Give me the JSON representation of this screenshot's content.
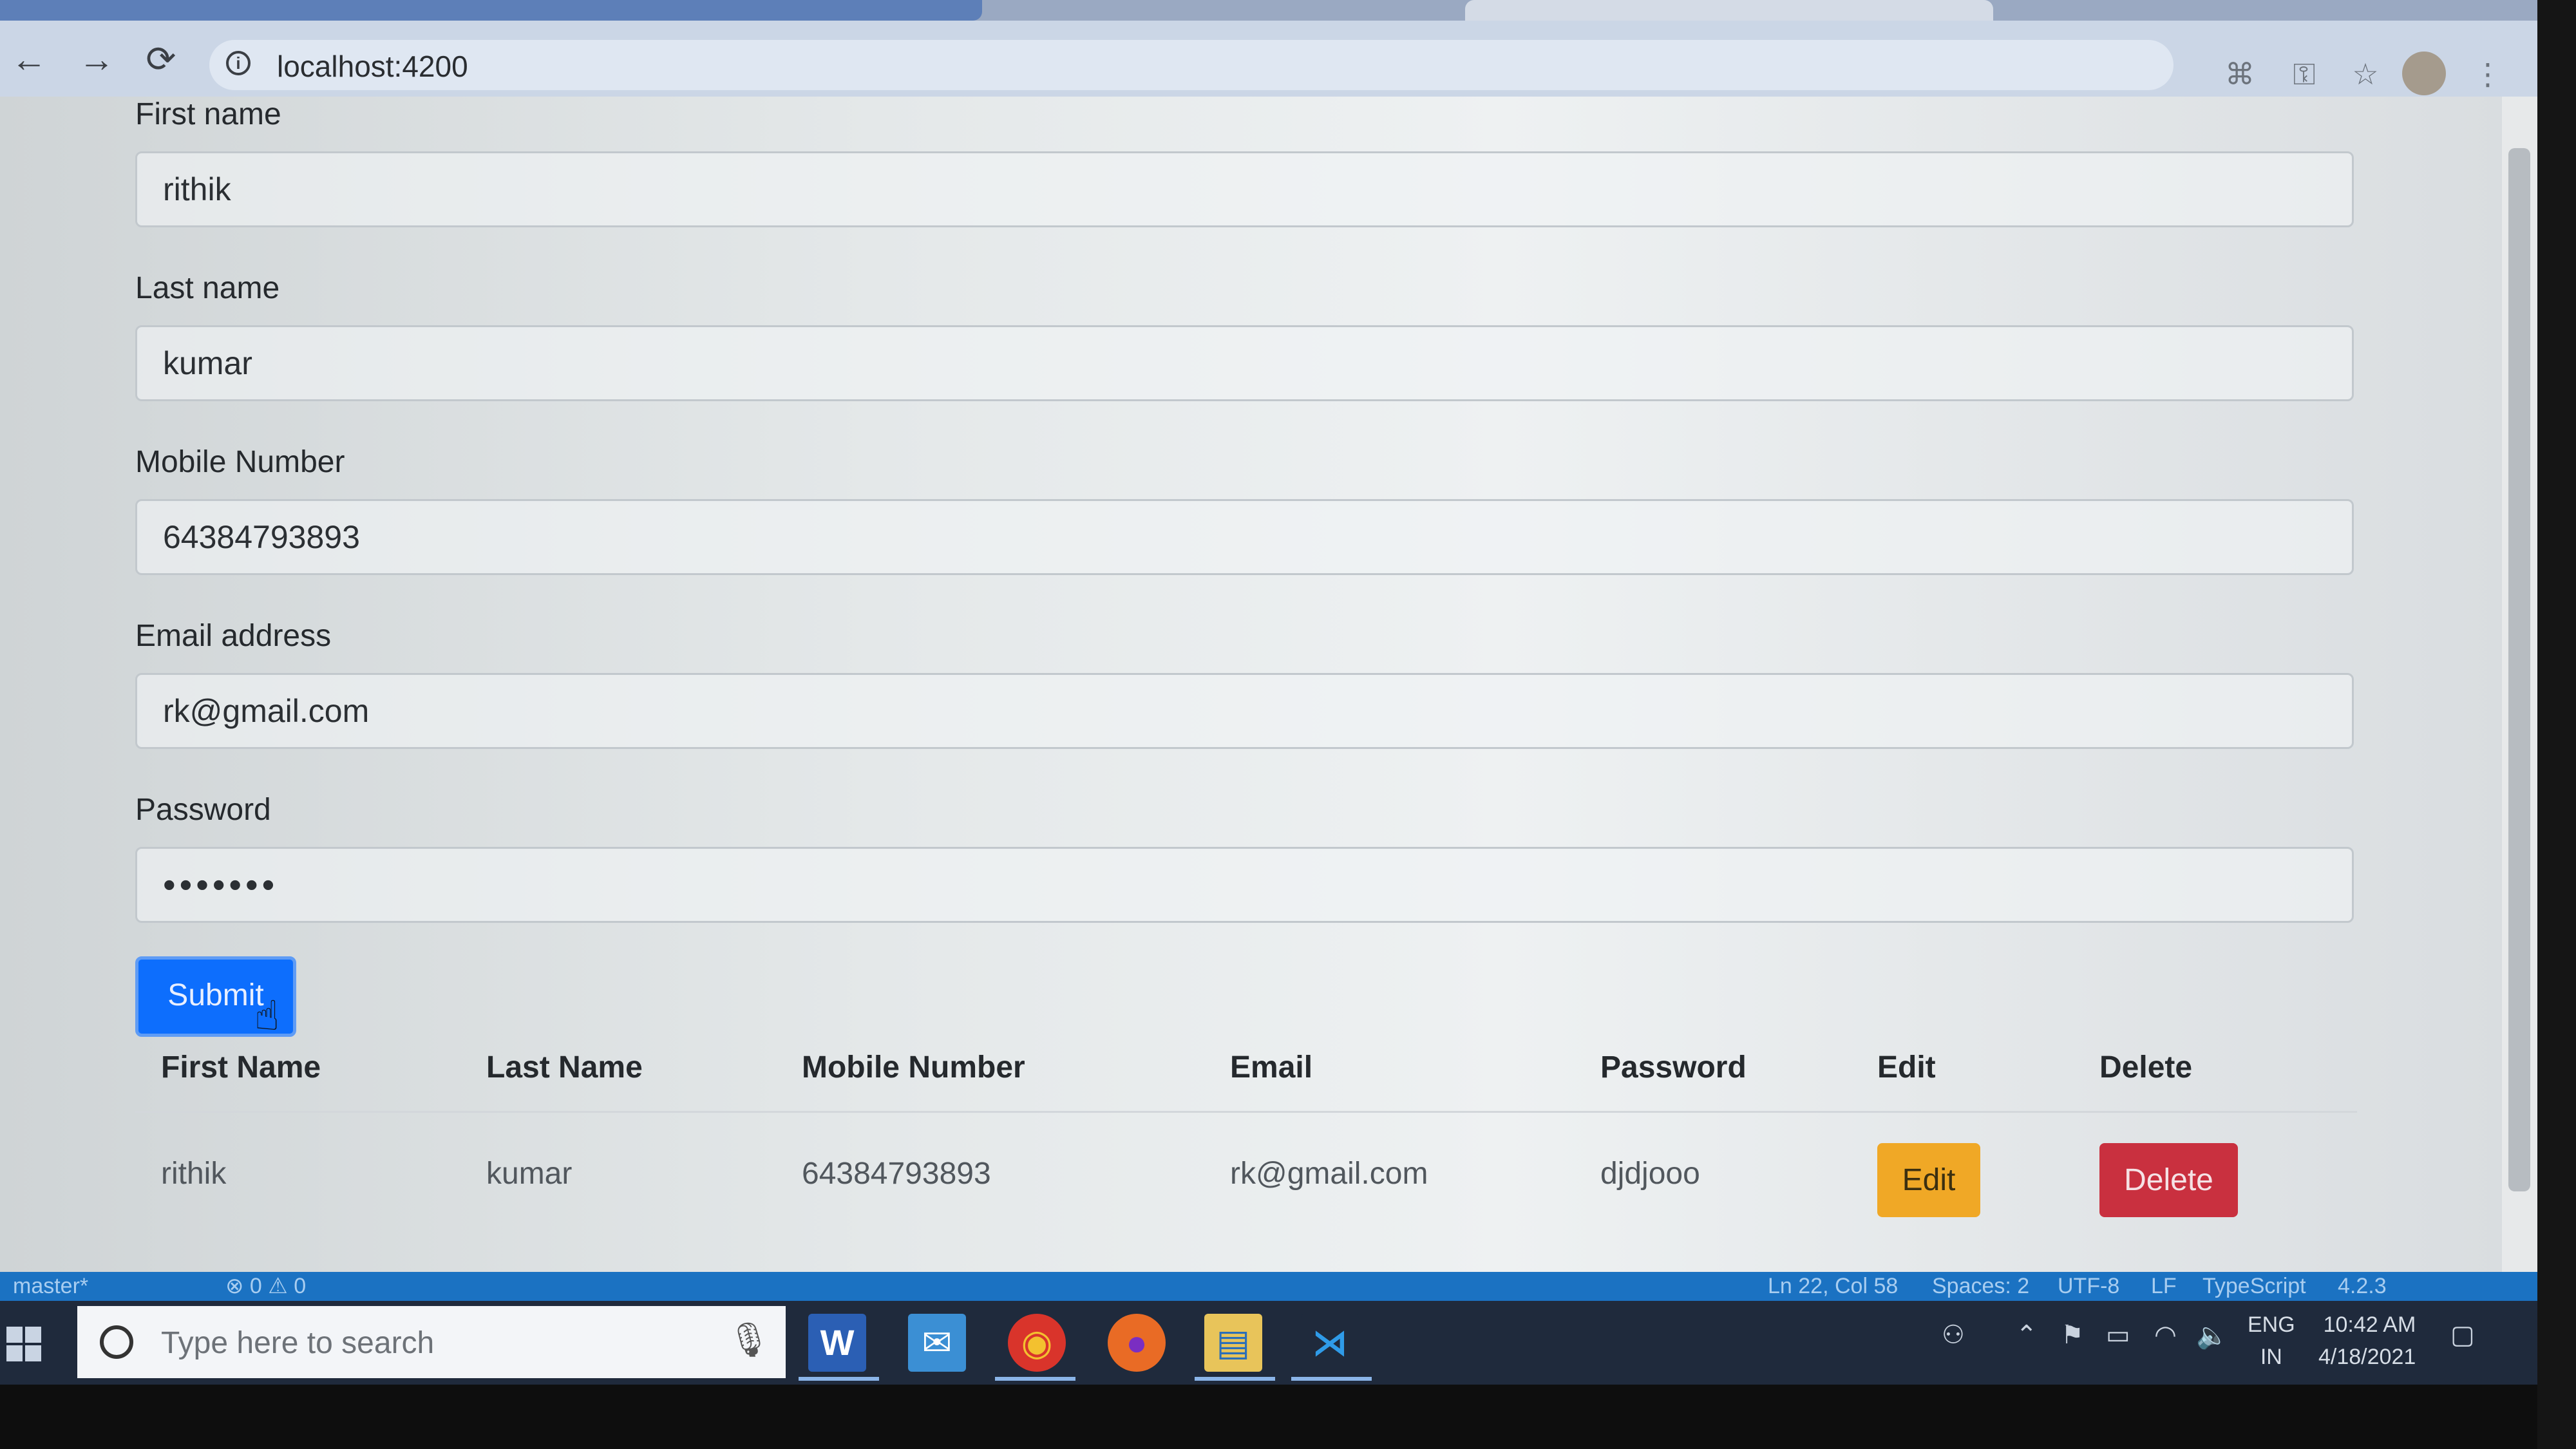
{
  "browser": {
    "url": "localhost:4200",
    "back_icon": "←",
    "forward_icon": "→",
    "reload_icon": "⟳",
    "key_icon": "⚿",
    "star_icon": "☆",
    "menu_icon": "⋮"
  },
  "form": {
    "first_name": {
      "label": "First name",
      "value": "rithik"
    },
    "last_name": {
      "label": "Last name",
      "value": "kumar"
    },
    "mobile": {
      "label": "Mobile Number",
      "value": "64384793893"
    },
    "email": {
      "label": "Email address",
      "value": "rk@gmail.com"
    },
    "password": {
      "label": "Password",
      "value": "•••••••"
    },
    "submit_label": "Submit"
  },
  "table": {
    "headers": [
      "First Name",
      "Last Name",
      "Mobile Number",
      "Email",
      "Password",
      "Edit",
      "Delete"
    ],
    "rows": [
      {
        "first_name": "rithik",
        "last_name": "kumar",
        "mobile": "64384793893",
        "email": "rk@gmail.com",
        "password": "djdjooo",
        "edit_label": "Edit",
        "delete_label": "Delete"
      }
    ]
  },
  "statusbar": {
    "branch": "master*",
    "problems": "⊗ 0 ⚠ 0",
    "position": "Ln 22, Col 58",
    "spaces": "Spaces: 2",
    "encoding": "UTF-8",
    "eol": "LF",
    "language": "TypeScript",
    "version": "4.2.3"
  },
  "taskbar": {
    "search_placeholder": "Type here to search",
    "language_line1": "ENG",
    "language_line2": "IN",
    "time": "10:42 AM",
    "date": "4/18/2021"
  }
}
